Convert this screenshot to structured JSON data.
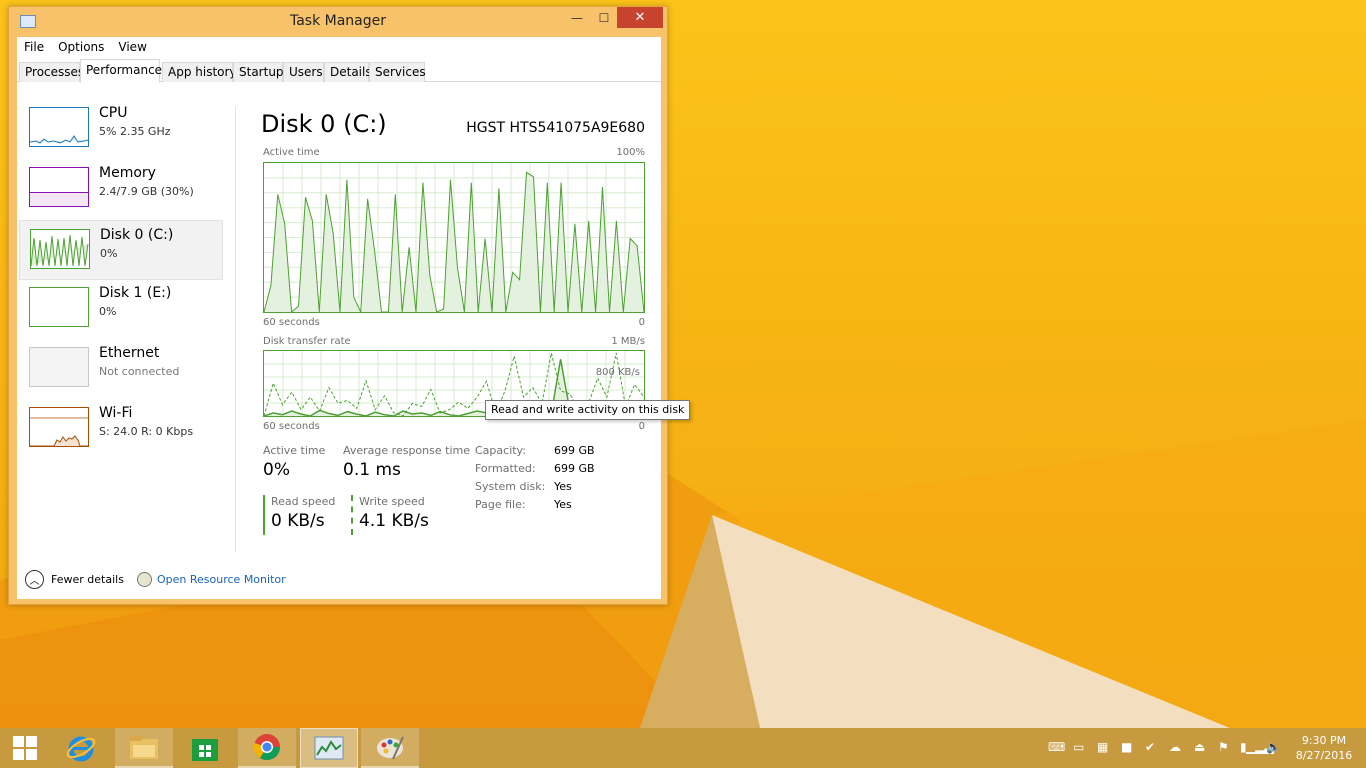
{
  "window": {
    "title": "Task Manager",
    "controls": {
      "minimize": "—",
      "maximize": "☐",
      "close": "✕"
    }
  },
  "menu": [
    "File",
    "Options",
    "View"
  ],
  "tabs": [
    "Processes",
    "Performance",
    "App history",
    "Startup",
    "Users",
    "Details",
    "Services"
  ],
  "active_tab": "Performance",
  "sidebar": {
    "items": [
      {
        "name": "CPU",
        "sub": "5%  2.35 GHz",
        "color": "#1779ba"
      },
      {
        "name": "Memory",
        "sub": "2.4/7.9 GB (30%)",
        "color": "#8b12ae"
      },
      {
        "name": "Disk 0 (C:)",
        "sub": "0%",
        "color": "#4da033"
      },
      {
        "name": "Disk 1 (E:)",
        "sub": "0%",
        "color": "#4da033"
      },
      {
        "name": "Ethernet",
        "sub": "Not connected",
        "color": "#c0c0c0"
      },
      {
        "name": "Wi-Fi",
        "sub": "S: 24.0  R: 0 Kbps",
        "color": "#a74f01"
      }
    ],
    "selected": "Disk 0 (C:)"
  },
  "main": {
    "title": "Disk 0 (C:)",
    "model": "HGST HTS541075A9E680",
    "active_graph": {
      "label": "Active time",
      "max_label": "100%",
      "x_left": "60 seconds",
      "x_right": "0",
      "values": [
        0,
        18,
        80,
        60,
        0,
        4,
        78,
        62,
        0,
        80,
        54,
        0,
        90,
        10,
        0,
        77,
        42,
        0,
        0,
        80,
        0,
        44,
        0,
        88,
        25,
        0,
        2,
        90,
        30,
        0,
        88,
        0,
        50,
        0,
        84,
        0,
        27,
        22,
        95,
        92,
        0,
        88,
        0,
        88,
        0,
        60,
        0,
        62,
        0,
        85,
        0,
        62,
        0,
        50,
        45,
        0
      ]
    },
    "transfer_graph": {
      "label": "Disk transfer rate",
      "max_label": "1 MB/s",
      "mid_label": "800 KB/s",
      "x_left": "60 seconds",
      "x_right": "0",
      "read": [
        0,
        5,
        2,
        8,
        3,
        0,
        9,
        4,
        1,
        7,
        3,
        0,
        6,
        2,
        0,
        8,
        3,
        5,
        1,
        7,
        2,
        0,
        4,
        8,
        5,
        10,
        3,
        0,
        6,
        14,
        2,
        4,
        90,
        8,
        5,
        0,
        3,
        2,
        6,
        0,
        4,
        3
      ],
      "write": [
        0,
        52,
        18,
        38,
        10,
        30,
        8,
        45,
        20,
        25,
        12,
        56,
        10,
        32,
        5,
        0,
        20,
        15,
        42,
        5,
        10,
        22,
        12,
        30,
        55,
        5,
        40,
        95,
        30,
        45,
        20,
        100,
        40,
        35,
        10,
        20,
        60,
        30,
        100,
        15,
        50,
        30
      ]
    },
    "tooltip": "Read and write activity on this disk",
    "stats": {
      "active_time": {
        "label": "Active time",
        "value": "0%"
      },
      "avg_response": {
        "label": "Average response time",
        "value": "0.1 ms"
      },
      "read_speed": {
        "label": "Read speed",
        "value": "0 KB/s"
      },
      "write_speed": {
        "label": "Write speed",
        "value": "4.1 KB/s"
      }
    },
    "properties": [
      {
        "label": "Capacity:",
        "value": "699 GB"
      },
      {
        "label": "Formatted:",
        "value": "699 GB"
      },
      {
        "label": "System disk:",
        "value": "Yes"
      },
      {
        "label": "Page file:",
        "value": "Yes"
      }
    ]
  },
  "footer": {
    "fewer_details": "Fewer details",
    "resource_monitor": "Open Resource Monitor"
  },
  "taskbar": {
    "apps": [
      "Start",
      "Internet Explorer",
      "File Explorer",
      "Store",
      "Google Chrome",
      "Task Manager",
      "Paint"
    ],
    "clock_time": "9:30 PM",
    "clock_date": "8/27/2016"
  },
  "colors": {
    "disk_green": "#4da033",
    "desktop_orange": "#f6b512",
    "close_red": "#c7432e"
  }
}
